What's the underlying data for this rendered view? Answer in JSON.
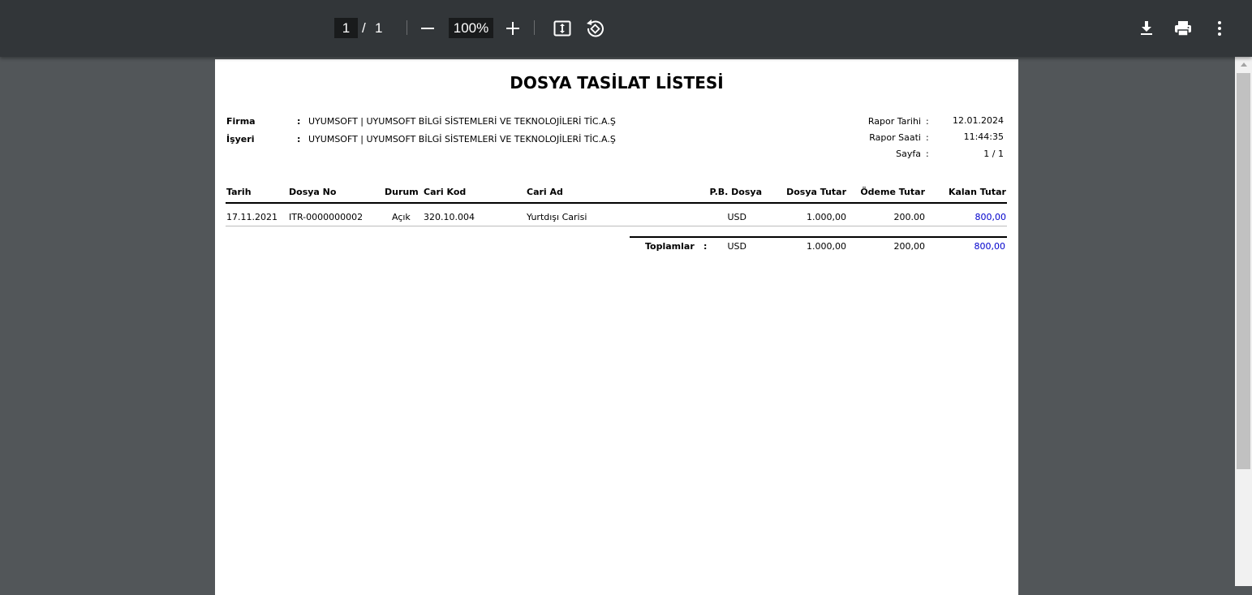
{
  "toolbar": {
    "page_current": "1",
    "page_separator": "/",
    "page_total": "1",
    "zoom": "100%"
  },
  "report": {
    "title": "DOSYA TASİLAT LİSTESİ",
    "firma_label": "Firma",
    "firma_colon": ":",
    "firma_value": "UYUMSOFT | UYUMSOFT BİLGİ SİSTEMLERİ VE TEKNOLOJİLERİ TİC.A.Ş",
    "isyeri_label": "İşyeri",
    "isyeri_colon": ":",
    "isyeri_value": "UYUMSOFT | UYUMSOFT BİLGİ SİSTEMLERİ VE TEKNOLOJİLERİ TİC.A.Ş",
    "rapor_tarihi_label": "Rapor Tarihi",
    "rapor_tarihi_colon": ":",
    "rapor_tarihi_value": "12.01.2024",
    "rapor_saati_label": "Rapor Saati",
    "rapor_saati_colon": ":",
    "rapor_saati_value": "11:44:35",
    "sayfa_label": "Sayfa",
    "sayfa_colon": ":",
    "sayfa_value": "1 / 1"
  },
  "table": {
    "headers": {
      "tarih": "Tarih",
      "dosya_no": "Dosya No",
      "durum": "Durum",
      "cari_kod": "Cari Kod",
      "cari_ad": "Cari Ad",
      "pb_dosya": "P.B. Dosya",
      "dosya_tutar": "Dosya Tutar",
      "odeme_tutar": "Ödeme Tutar",
      "kalan_tutar": "Kalan Tutar"
    },
    "rows": [
      {
        "tarih": "17.11.2021",
        "dosya_no": "ITR-0000000002",
        "durum": "Açık",
        "cari_kod": "320.10.004",
        "cari_ad": "Yurtdışı Carisi",
        "pb_dosya": "USD",
        "dosya_tutar": "1.000,00",
        "odeme_tutar": "200.00",
        "kalan_tutar": "800,00"
      }
    ],
    "totals": {
      "label": "Toplamlar",
      "colon": ":",
      "pb_dosya": "USD",
      "dosya_tutar": "1.000,00",
      "odeme_tutar": "200,00",
      "kalan_tutar": "800,00"
    }
  },
  "colors": {
    "toolbar_bg": "#323639",
    "viewer_bg": "#525659",
    "kalan_tutar": "#0000cc"
  },
  "icons": [
    "minus-icon",
    "plus-icon",
    "fit-page-icon",
    "rotate-icon",
    "download-icon",
    "print-icon",
    "more-vert-icon"
  ]
}
